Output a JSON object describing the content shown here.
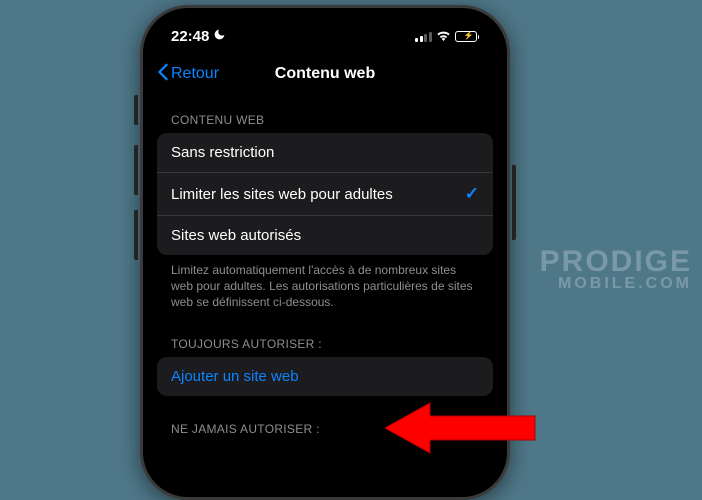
{
  "status": {
    "time": "22:48",
    "moon_icon": "moon-icon"
  },
  "nav": {
    "back_label": "Retour",
    "title": "Contenu web"
  },
  "section1": {
    "header": "CONTENU WEB",
    "items": [
      {
        "label": "Sans restriction",
        "checked": false
      },
      {
        "label": "Limiter les sites web pour adultes",
        "checked": true
      },
      {
        "label": "Sites web autorisés",
        "checked": false
      }
    ],
    "footer": "Limitez automatiquement l'accès à de nombreux sites web pour adultes. Les autorisations particulières de sites web se définissent ci-dessous."
  },
  "section2": {
    "header": "TOUJOURS AUTORISER :",
    "add_label": "Ajouter un site web"
  },
  "section3": {
    "header": "NE JAMAIS AUTORISER :"
  },
  "watermark": {
    "line1": "PRODIGE",
    "line2": "MOBILE.COM"
  }
}
